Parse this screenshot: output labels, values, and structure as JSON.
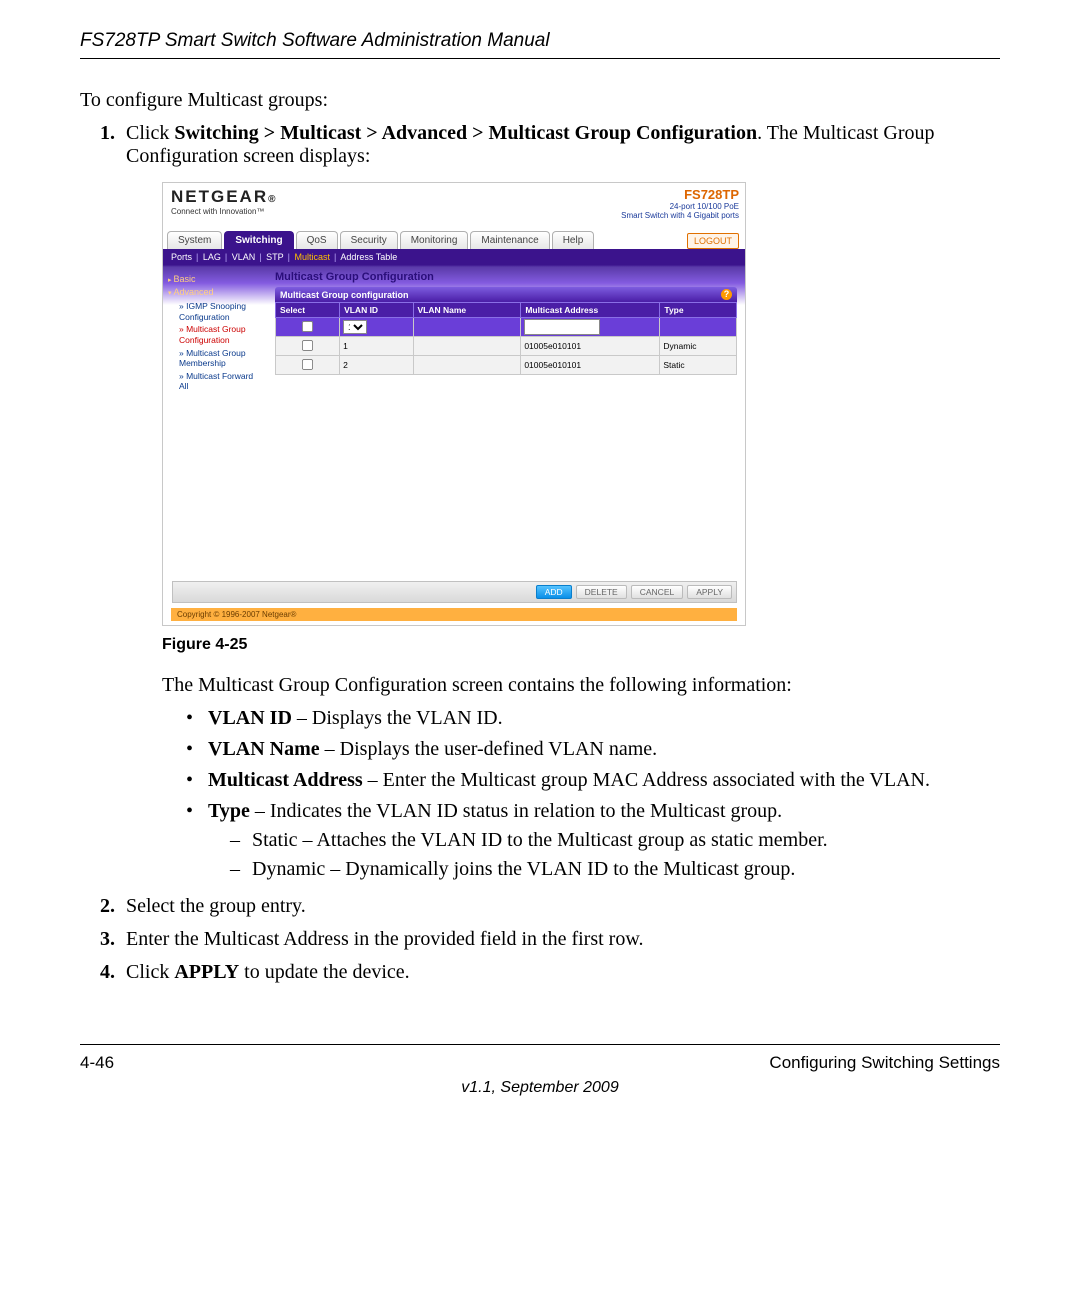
{
  "header": {
    "title": "FS728TP Smart Switch Software Administration Manual"
  },
  "intro": "To configure Multicast groups:",
  "step1": {
    "pre": "Click ",
    "bold": "Switching > Multicast > Advanced > Multicast Group Configuration",
    "post": ". The Multicast Group Configuration screen displays:"
  },
  "shot": {
    "brand_name": "NETGEAR",
    "brand_tag": "Connect with Innovation™",
    "model": "FS728TP",
    "model_desc1": "24-port 10/100 PoE",
    "model_desc2": "Smart Switch with 4 Gigabit ports",
    "tabs": [
      "System",
      "Switching",
      "QoS",
      "Security",
      "Monitoring",
      "Maintenance",
      "Help"
    ],
    "active_tab": 1,
    "logout": "LOGOUT",
    "subtabs": [
      "Ports",
      "LAG",
      "VLAN",
      "STP",
      "Multicast",
      "Address Table"
    ],
    "subtab_on": 4,
    "left": {
      "basic": "Basic",
      "advanced": "Advanced",
      "links": [
        {
          "label": "IGMP Snooping Configuration",
          "sel": false
        },
        {
          "label": "Multicast Group Configuration",
          "sel": true
        },
        {
          "label": "Multicast Group Membership",
          "sel": false
        },
        {
          "label": "Multicast Forward All",
          "sel": false
        }
      ]
    },
    "content_title": "Multicast Group Configuration",
    "panel_title": "Multicast Group configuration",
    "cols": [
      "Select",
      "VLAN ID",
      "VLAN Name",
      "Multicast Address",
      "Type"
    ],
    "rows": [
      {
        "vlan": "1",
        "addr": "01005e010101",
        "type": "Dynamic"
      },
      {
        "vlan": "2",
        "addr": "01005e010101",
        "type": "Static"
      }
    ],
    "vlan_sel_default": "1",
    "buttons": {
      "add": "ADD",
      "delete": "DELETE",
      "cancel": "CANCEL",
      "apply": "APPLY"
    },
    "copyright": "Copyright © 1996-2007 Netgear®"
  },
  "figure": "Figure 4-25",
  "after_fig": "The Multicast Group Configuration screen contains the following information:",
  "fields": [
    {
      "b": "VLAN ID",
      "t": " – Displays the VLAN ID."
    },
    {
      "b": "VLAN Name",
      "t": " – Displays the user-defined VLAN name."
    },
    {
      "b": "Multicast Address",
      "t": " – Enter the Multicast group MAC Address associated with the VLAN."
    },
    {
      "b": "Type",
      "t": " – Indicates the VLAN ID status in relation to the Multicast group.",
      "sub": [
        "Static – Attaches the VLAN ID to the Multicast group as static member.",
        "Dynamic – Dynamically joins the VLAN ID to the Multicast group."
      ]
    }
  ],
  "step2": "Select the group entry.",
  "step3": "Enter the Multicast Address in the provided field in the first row.",
  "step4_pre": "Click ",
  "step4_b": "APPLY",
  "step4_post": " to update the device.",
  "footer": {
    "pgnum": "4-46",
    "section": "Configuring Switching Settings",
    "version": "v1.1, September 2009"
  }
}
